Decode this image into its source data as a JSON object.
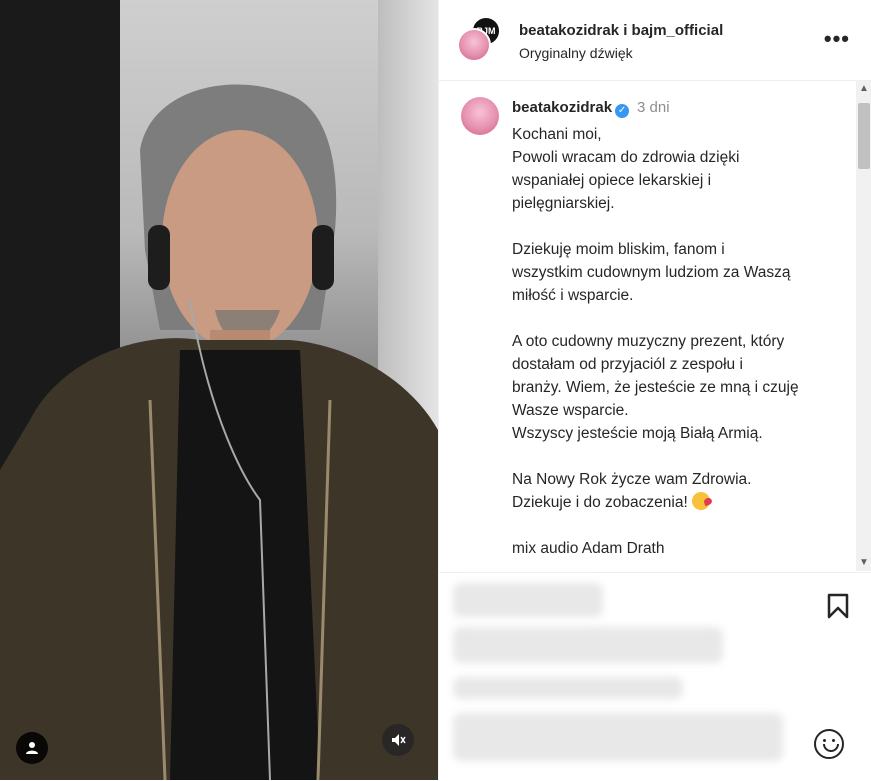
{
  "header": {
    "names": "beatakozidrak i bajm_official",
    "audio_label": "Oryginalny dźwięk",
    "avatar_logo_text": "BJM",
    "more_label": "•••"
  },
  "caption": {
    "username": "beatakozidrak",
    "verified_mark": "✓",
    "time": "3 dni",
    "paragraphs": {
      "p1": [
        "Kochani moi,",
        "Powoli wracam do zdrowia dzięki",
        "wspaniałej opiece lekarskiej i",
        "pielęgniarskiej."
      ],
      "p2": [
        "Dziekuję moim bliskim, fanom i",
        "wszystkim cudownym ludziom za Waszą",
        "miłość i wsparcie."
      ],
      "p3": [
        "A oto cudowny muzyczny prezent, który",
        "dostałam od przyjaciól z zespołu i",
        "branży. Wiem, że jesteście ze mną i czuję",
        "Wasze wsparcie.",
        "Wszyscy jesteście moją Białą Armią."
      ],
      "p4": [
        "Na Nowy Rok życze wam Zdrowia.",
        "Dziekuje i do zobaczenia! "
      ],
      "p5": [
        "mix audio Adam Drath"
      ]
    }
  },
  "scrollbar": {
    "up": "▲",
    "down": "▼"
  },
  "icons": {
    "user_tag": "user-silhouette-icon",
    "mute": "speaker-muted-icon",
    "save": "bookmark-icon",
    "emoji": "smiley-face-icon",
    "kiss_emoji": "face-blowing-kiss"
  },
  "colors": {
    "verified": "#3897f0",
    "text": "#262626",
    "muted_text": "#8e8e8e",
    "divider": "#efefef"
  }
}
